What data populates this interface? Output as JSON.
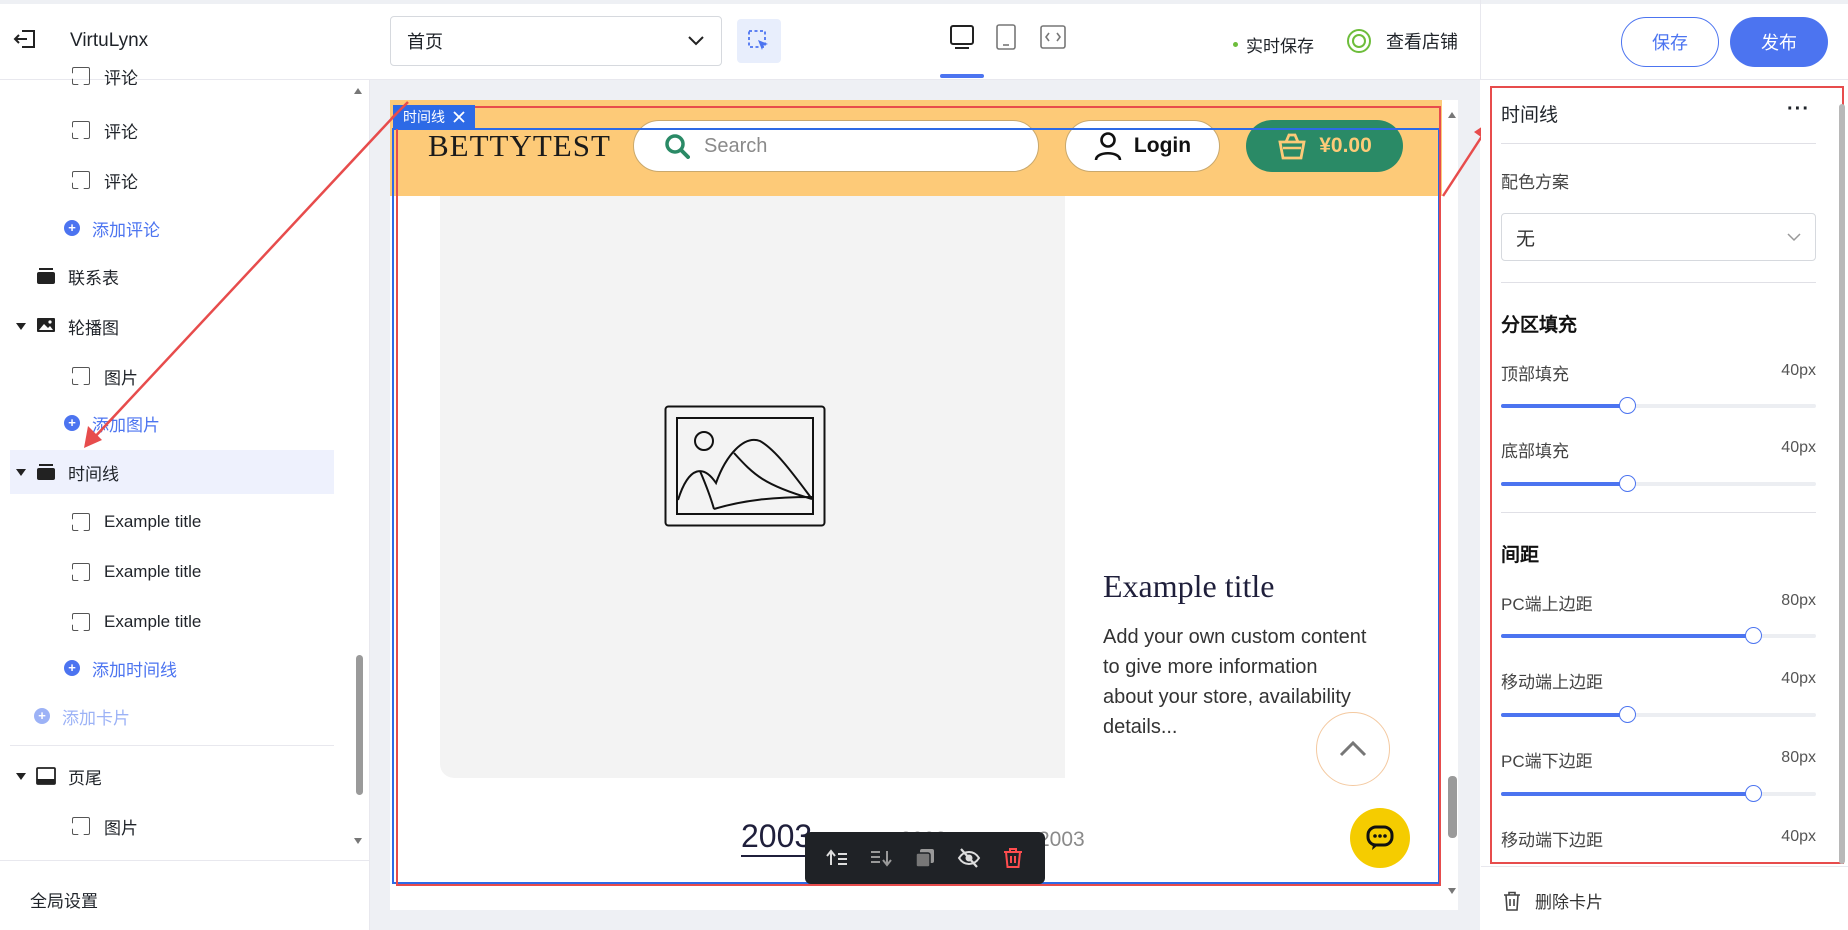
{
  "header": {
    "brand": "VirtuLynx",
    "page_select": "首页",
    "autosave": "实时保存",
    "view_store": "查看店铺",
    "save": "保存",
    "publish": "发布"
  },
  "tree": {
    "comment_partial": "评论",
    "comment_1": "评论",
    "comment_2": "评论",
    "add_comment": "添加评论",
    "contact_form": "联系表",
    "carousel": "轮播图",
    "carousel_image": "图片",
    "add_image": "添加图片",
    "timeline": "时间线",
    "timeline_items": [
      "Example title",
      "Example title",
      "Example title"
    ],
    "add_timeline": "添加时间线",
    "add_card": "添加卡片",
    "footer": "页尾",
    "footer_image": "图片",
    "global_settings": "全局设置"
  },
  "preview": {
    "selection_tag": "时间线",
    "store_logo": "BETTYTEST",
    "search_placeholder": "Search",
    "login": "Login",
    "cart_total": "¥0.00",
    "timeline_title": "Example title",
    "timeline_desc": "Add your own custom content to give more information about your store, availability details...",
    "years": [
      "2003",
      "2003",
      "2003"
    ]
  },
  "settings": {
    "title": "时间线",
    "color_scheme_label": "配色方案",
    "color_scheme_value": "无",
    "section_padding": "分区填充",
    "top_padding": {
      "label": "顶部填充",
      "value": "40px",
      "fraction": 0.4
    },
    "bottom_padding": {
      "label": "底部填充",
      "value": "40px",
      "fraction": 0.4
    },
    "spacing": "间距",
    "pc_top": {
      "label": "PC端上边距",
      "value": "80px",
      "fraction": 0.8
    },
    "mobile_top": {
      "label": "移动端上边距",
      "value": "40px",
      "fraction": 0.4
    },
    "pc_bottom": {
      "label": "PC端下边距",
      "value": "80px",
      "fraction": 0.8
    },
    "mobile_bottom": {
      "label": "移动端下边距",
      "value": "40px",
      "fraction": 0.4
    },
    "delete_card": "删除卡片"
  },
  "colors": {
    "accent": "#4c74f0",
    "header_bg": "#fdca78",
    "cart_bg": "#2a8a66",
    "annotation_red": "#e74c4c",
    "selection_blue": "#2d6ae6",
    "chat": "#f5cc00"
  }
}
